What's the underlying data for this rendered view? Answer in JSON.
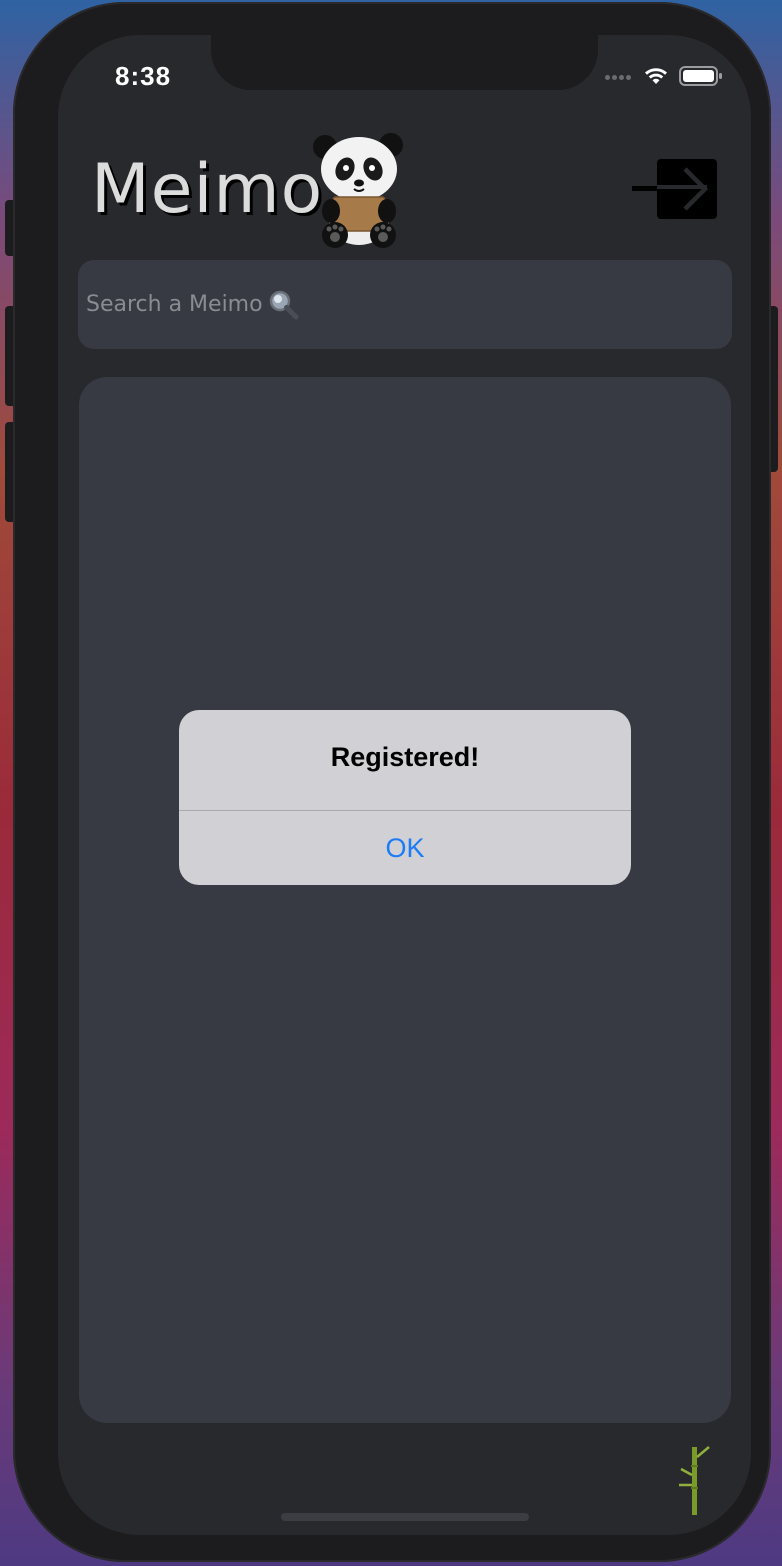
{
  "status_bar": {
    "time": "8:38",
    "wifi_icon": "wifi-icon",
    "battery_icon": "battery-icon"
  },
  "header": {
    "app_title": "Meimo",
    "logo_icon": "panda-icon",
    "logout_icon": "logout-arrow-icon"
  },
  "search": {
    "placeholder": "Search a Meimo",
    "value": "",
    "icon": "magnifier-icon"
  },
  "alert": {
    "title": "Registered!",
    "ok_label": "OK"
  },
  "footer": {
    "decor_icon": "bamboo-icon"
  },
  "colors": {
    "background": "#28292d",
    "panel": "#373a42",
    "alert_bg": "#d0d0d5",
    "accent_blue": "#1d7bf3",
    "title_text": "#dcdcdc"
  }
}
